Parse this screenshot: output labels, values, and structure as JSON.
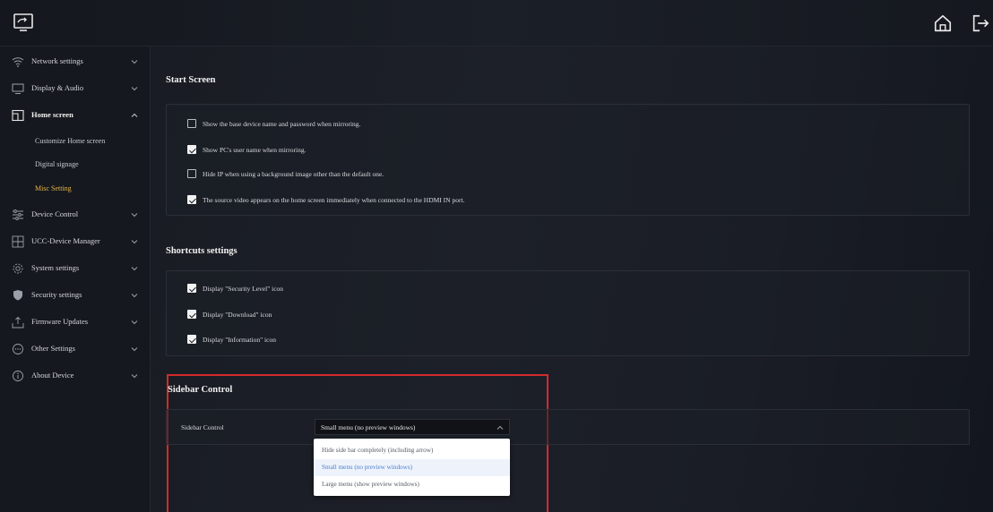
{
  "sidebar": {
    "items": [
      {
        "label": "Network settings",
        "icon": "wifi-icon"
      },
      {
        "label": "Display & Audio",
        "icon": "monitor-icon"
      },
      {
        "label": "Home screen",
        "icon": "home-screen-icon"
      },
      {
        "label": "Device Control",
        "icon": "sliders-icon"
      },
      {
        "label": "UCC-Device Manager",
        "icon": "device-manager-icon"
      },
      {
        "label": "System settings",
        "icon": "gear-icon"
      },
      {
        "label": "Security settings",
        "icon": "shield-icon"
      },
      {
        "label": "Firmware Updates",
        "icon": "upload-icon"
      },
      {
        "label": "Other Settings",
        "icon": "more-icon"
      },
      {
        "label": "About Device",
        "icon": "info-icon"
      }
    ],
    "home_sub": [
      {
        "label": "Customize Home screen"
      },
      {
        "label": "Digital signage"
      },
      {
        "label": "Misc Setting"
      }
    ]
  },
  "start_screen": {
    "title": "Start Screen",
    "options": [
      {
        "label": "Show the base device name and password when mirroring.",
        "checked": false
      },
      {
        "label": "Show PC's user name when mirroring.",
        "checked": true
      },
      {
        "label": "Hide IP when using a background image other than the default one.",
        "checked": false
      },
      {
        "label": "The source video appears on the home screen immediately when connected to the HDMI IN port.",
        "checked": true
      }
    ]
  },
  "shortcuts": {
    "title": "Shortcuts settings",
    "options": [
      {
        "label": "Display \"Security Level\" icon",
        "checked": true
      },
      {
        "label": "Display \"Download\" icon",
        "checked": true
      },
      {
        "label": "Display \"Information\" icon",
        "checked": true
      }
    ]
  },
  "sidebar_control": {
    "title": "Sidebar Control",
    "field_label": "Sidebar Control",
    "selected": "Small menu (no preview windows)",
    "options": [
      "Hide side bar completely (including arrow)",
      "Small menu (no preview windows)",
      "Large menu (show preview windows)"
    ]
  },
  "colors": {
    "accent": "#e8b54a",
    "highlight_border": "#d22b2b",
    "selected_option": "#4a7fd1"
  }
}
